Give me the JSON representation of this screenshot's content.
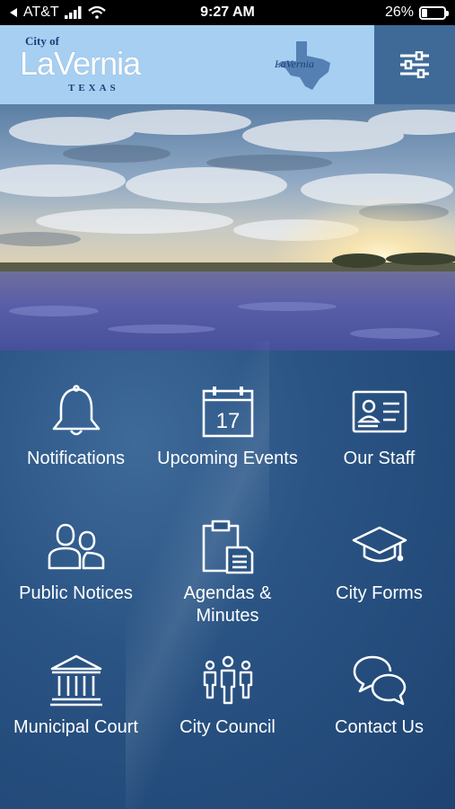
{
  "status_bar": {
    "carrier": "AT&T",
    "time": "9:27 AM",
    "battery_percent": "26%",
    "battery_level": 0.26
  },
  "header": {
    "logo_city_of": "City of",
    "logo_name": "LaVernia",
    "logo_state": "TEXAS",
    "secondary_logo_text": "LaVernia",
    "menu_icon": "sliders-icon"
  },
  "hero": {
    "description_icon": "bluebonnet-field-image"
  },
  "tiles": [
    {
      "label": "Notifications",
      "icon": "bell-icon"
    },
    {
      "label": "Upcoming Events",
      "icon": "calendar-icon",
      "calendar_day": "17"
    },
    {
      "label": "Our Staff",
      "icon": "id-card-icon"
    },
    {
      "label": "Public Notices",
      "icon": "people-icon"
    },
    {
      "label": "Agendas & Minutes",
      "icon": "clipboard-icon"
    },
    {
      "label": "City Forms",
      "icon": "graduation-cap-icon"
    },
    {
      "label": "Municipal Court",
      "icon": "courthouse-icon"
    },
    {
      "label": "City Council",
      "icon": "council-icon"
    },
    {
      "label": "Contact Us",
      "icon": "chat-bubbles-icon"
    }
  ],
  "colors": {
    "header_bg": "#a7cff2",
    "menu_bg": "#3f6a98",
    "grid_bg": "#2a5484"
  }
}
